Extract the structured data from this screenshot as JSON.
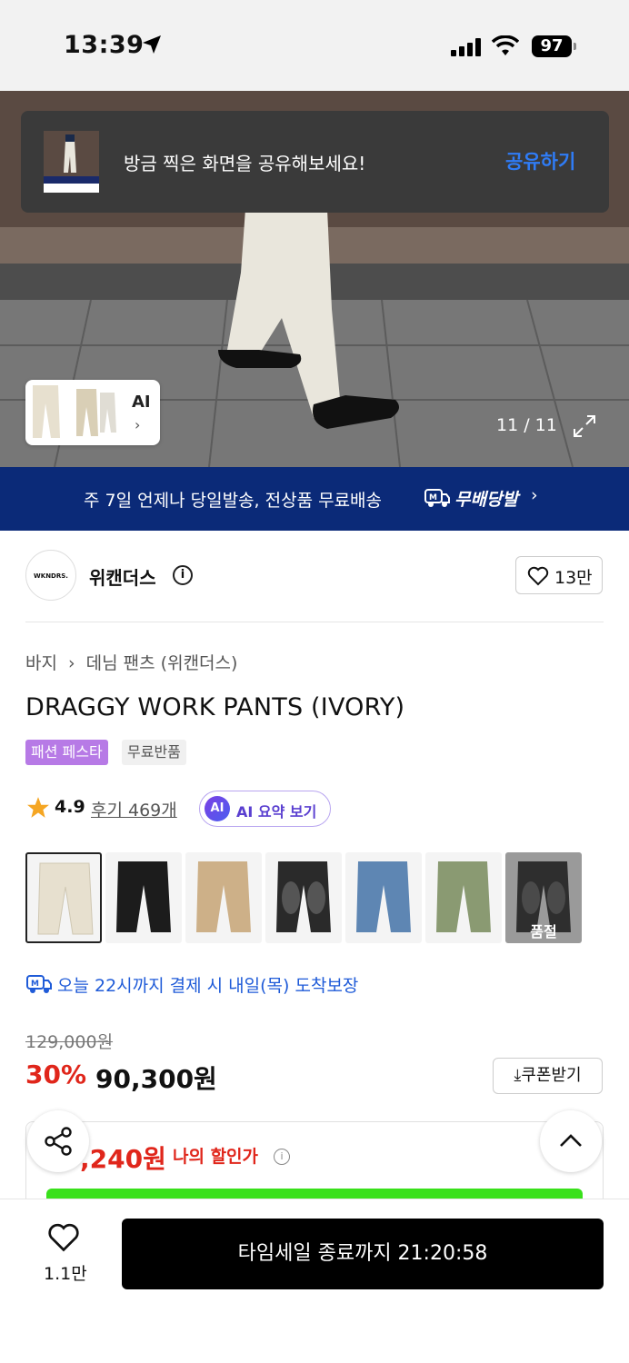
{
  "status_bar": {
    "time": "13:39",
    "battery": "97"
  },
  "toast": {
    "message": "방금 찍은 화면을 공유해보세요!",
    "action": "공유하기"
  },
  "hero": {
    "ai_label": "AI",
    "ai_chevron": "›",
    "counter": "11 / 11"
  },
  "banner": {
    "text": "주 7일 언제나 당일발송, 전상품 무료배송",
    "logo_text": "무배당발",
    "chevron": "›"
  },
  "brand": {
    "logo_text": "WKNDRS.",
    "name": "위캔더스",
    "info": "i",
    "likes": "13만"
  },
  "breadcrumb": [
    "바지",
    "›",
    "데님 팬츠 (위캔더스)"
  ],
  "product": {
    "title": "DRAGGY WORK PANTS (IVORY)",
    "badges": [
      "패션 페스타",
      "무료반품"
    ],
    "rating": "4.9",
    "reviews": "후기 469개",
    "ai_badge": "AI",
    "ai_summary": "AI 요약 보기"
  },
  "swatches": [
    {
      "color": "#e7e0cf",
      "selected": true
    },
    {
      "color": "#1c1c1c"
    },
    {
      "color": "#cdb088"
    },
    {
      "color": "#2a2a2a"
    },
    {
      "color": "#5e86b3"
    },
    {
      "color": "#8a9a72"
    },
    {
      "color": "#2e2e2e",
      "soldout_label": "품절"
    }
  ],
  "delivery": {
    "text": "오늘 22시까지 결제 시 내일(목) 도착보장"
  },
  "price": {
    "original": "129,000원",
    "discount": "30%",
    "sale": "90,300원",
    "coupon": "⤓쿠폰받기",
    "my_discount_price": ",240원",
    "my_discount_label": "나의 할인가",
    "info": "i"
  },
  "bottom": {
    "wish_count": "1.1만",
    "buy_label": "타임세일 종료까지 21:20:58"
  },
  "colors": {
    "accent_blue": "#2f7cf6",
    "sale_red": "#e0261b",
    "banner_navy": "#0b2a78",
    "festa_purple": "#b77ae6"
  }
}
